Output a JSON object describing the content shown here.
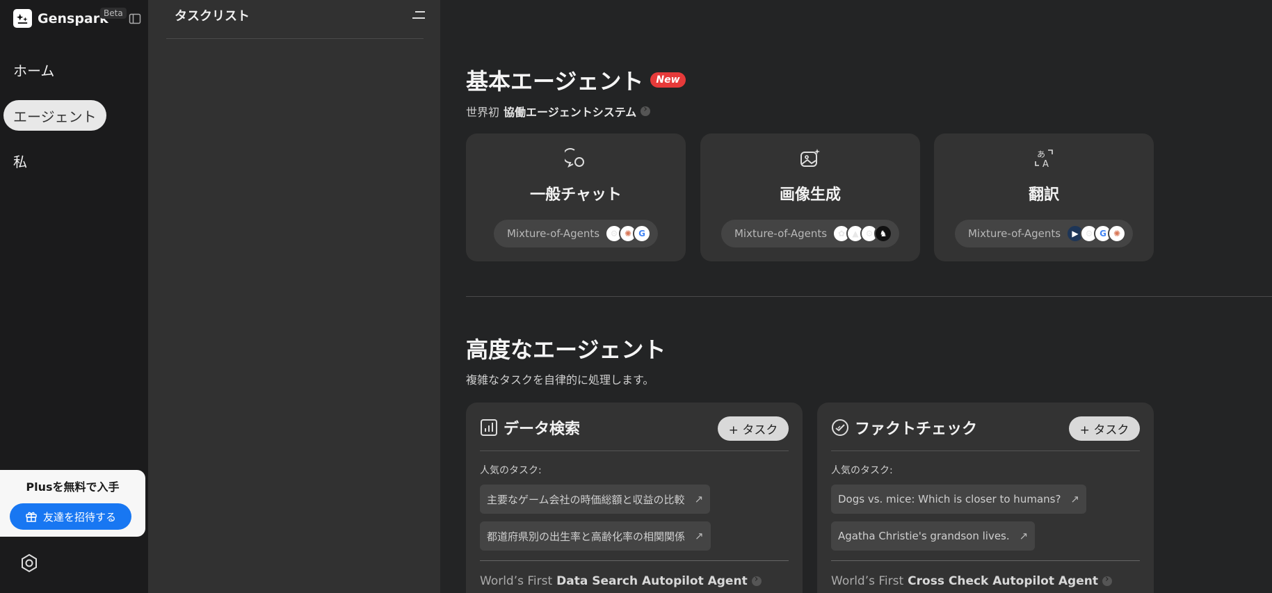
{
  "sidebar": {
    "brand": "Genspark",
    "beta": "Beta",
    "nav": [
      {
        "label": "ホーム"
      },
      {
        "label": "エージェント"
      },
      {
        "label": "私"
      }
    ],
    "promo_title": "Plusを無料で入手",
    "invite_label": "友達を招待する"
  },
  "taskpanel": {
    "title": "タスクリスト"
  },
  "basic": {
    "title": "基本エージェント",
    "badge": "New",
    "subtitle_prefix": "世界初",
    "subtitle_bold": "協働エージェントシステム",
    "cards": [
      {
        "title": "一般チャット",
        "moa": "Mixture-of-Agents",
        "icon": "chat-bubble-icon"
      },
      {
        "title": "画像生成",
        "moa": "Mixture-of-Agents",
        "icon": "image-sparkle-icon"
      },
      {
        "title": "翻訳",
        "moa": "Mixture-of-Agents",
        "icon": "translate-icon"
      }
    ]
  },
  "advanced": {
    "title": "高度なエージェント",
    "subtitle": "複雑なタスクを自律的に処理します。",
    "cards": [
      {
        "title": "データ検索",
        "add_label": "+ タスク",
        "popular_label": "人気のタスク:",
        "tasks": [
          "主要なゲーム会社の時価総額と収益の比較",
          "都道府県別の出生率と高齢化率の相関関係"
        ],
        "footer_prefix": "World’s First",
        "footer_bold": "Data Search Autopilot Agent"
      },
      {
        "title": "ファクトチェック",
        "add_label": "+ タスク",
        "popular_label": "人気のタスク:",
        "tasks": [
          "Dogs vs. mice: Which is closer to humans?",
          "Agatha Christie's grandson lives."
        ],
        "footer_prefix": "World’s First",
        "footer_bold": "Cross Check Autopilot Agent"
      }
    ]
  },
  "colors": {
    "accent_blue": "#1877f2",
    "new_badge": "#e63a3a"
  }
}
